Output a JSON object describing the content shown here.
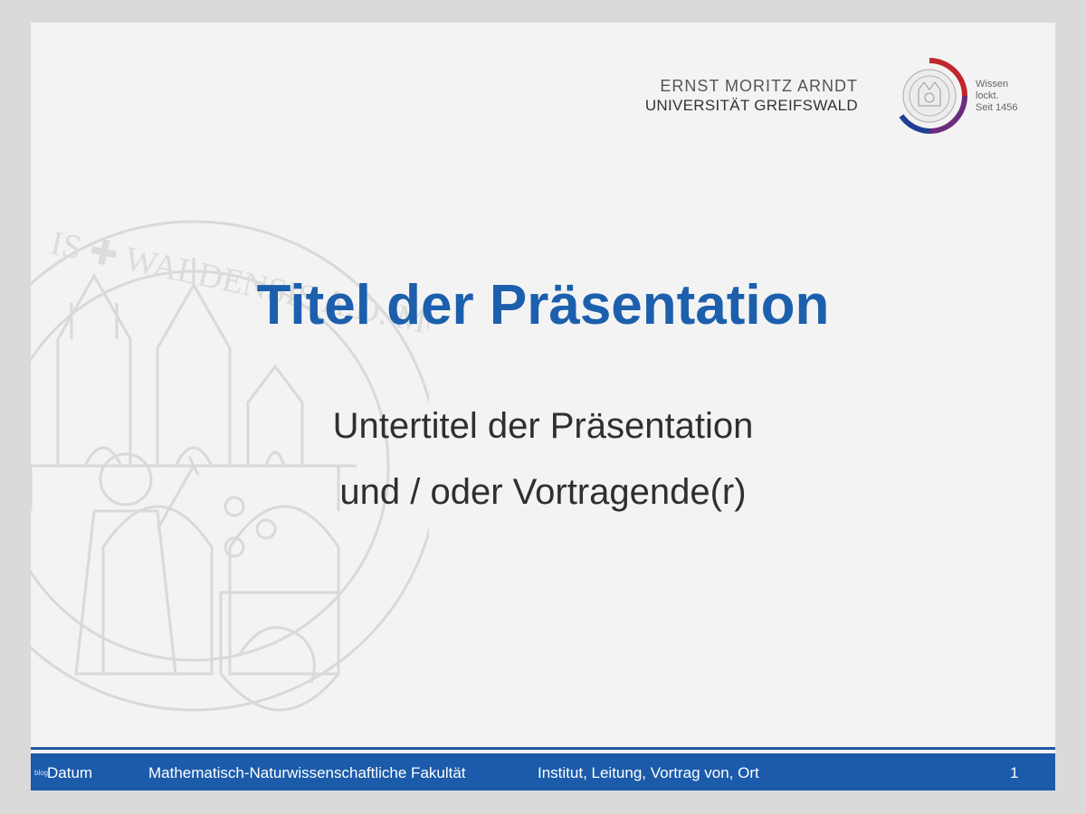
{
  "logo": {
    "line1": "ERNST MORITZ ARNDT",
    "line2": "UNIVERSITÄT GREIFSWALD",
    "slogan": [
      "Wissen",
      "lockt.",
      "Seit 1456"
    ],
    "colors": {
      "red": "#c0272d",
      "purple": "#6a2c7f",
      "blue": "#1f3f94"
    }
  },
  "seal": {
    "ring_text": "IS ✚ WALDENSIS A.D. MCCCCLVI"
  },
  "slide": {
    "title": "Titel der Präsentation",
    "subtitle_lines": [
      "Untertitel der Präsentation",
      "und / oder Vortragende(r)"
    ]
  },
  "footer": {
    "watermark": "blog",
    "date": "Datum",
    "faculty": "Mathematisch-Naturwissenschaftliche Fakultät",
    "institute": "Institut, Leitung, Vortrag von, Ort",
    "page": "1"
  },
  "colors": {
    "title_blue": "#1c5fad",
    "footer_blue": "#1b5baa",
    "slide_bg": "#f3f3f3"
  }
}
